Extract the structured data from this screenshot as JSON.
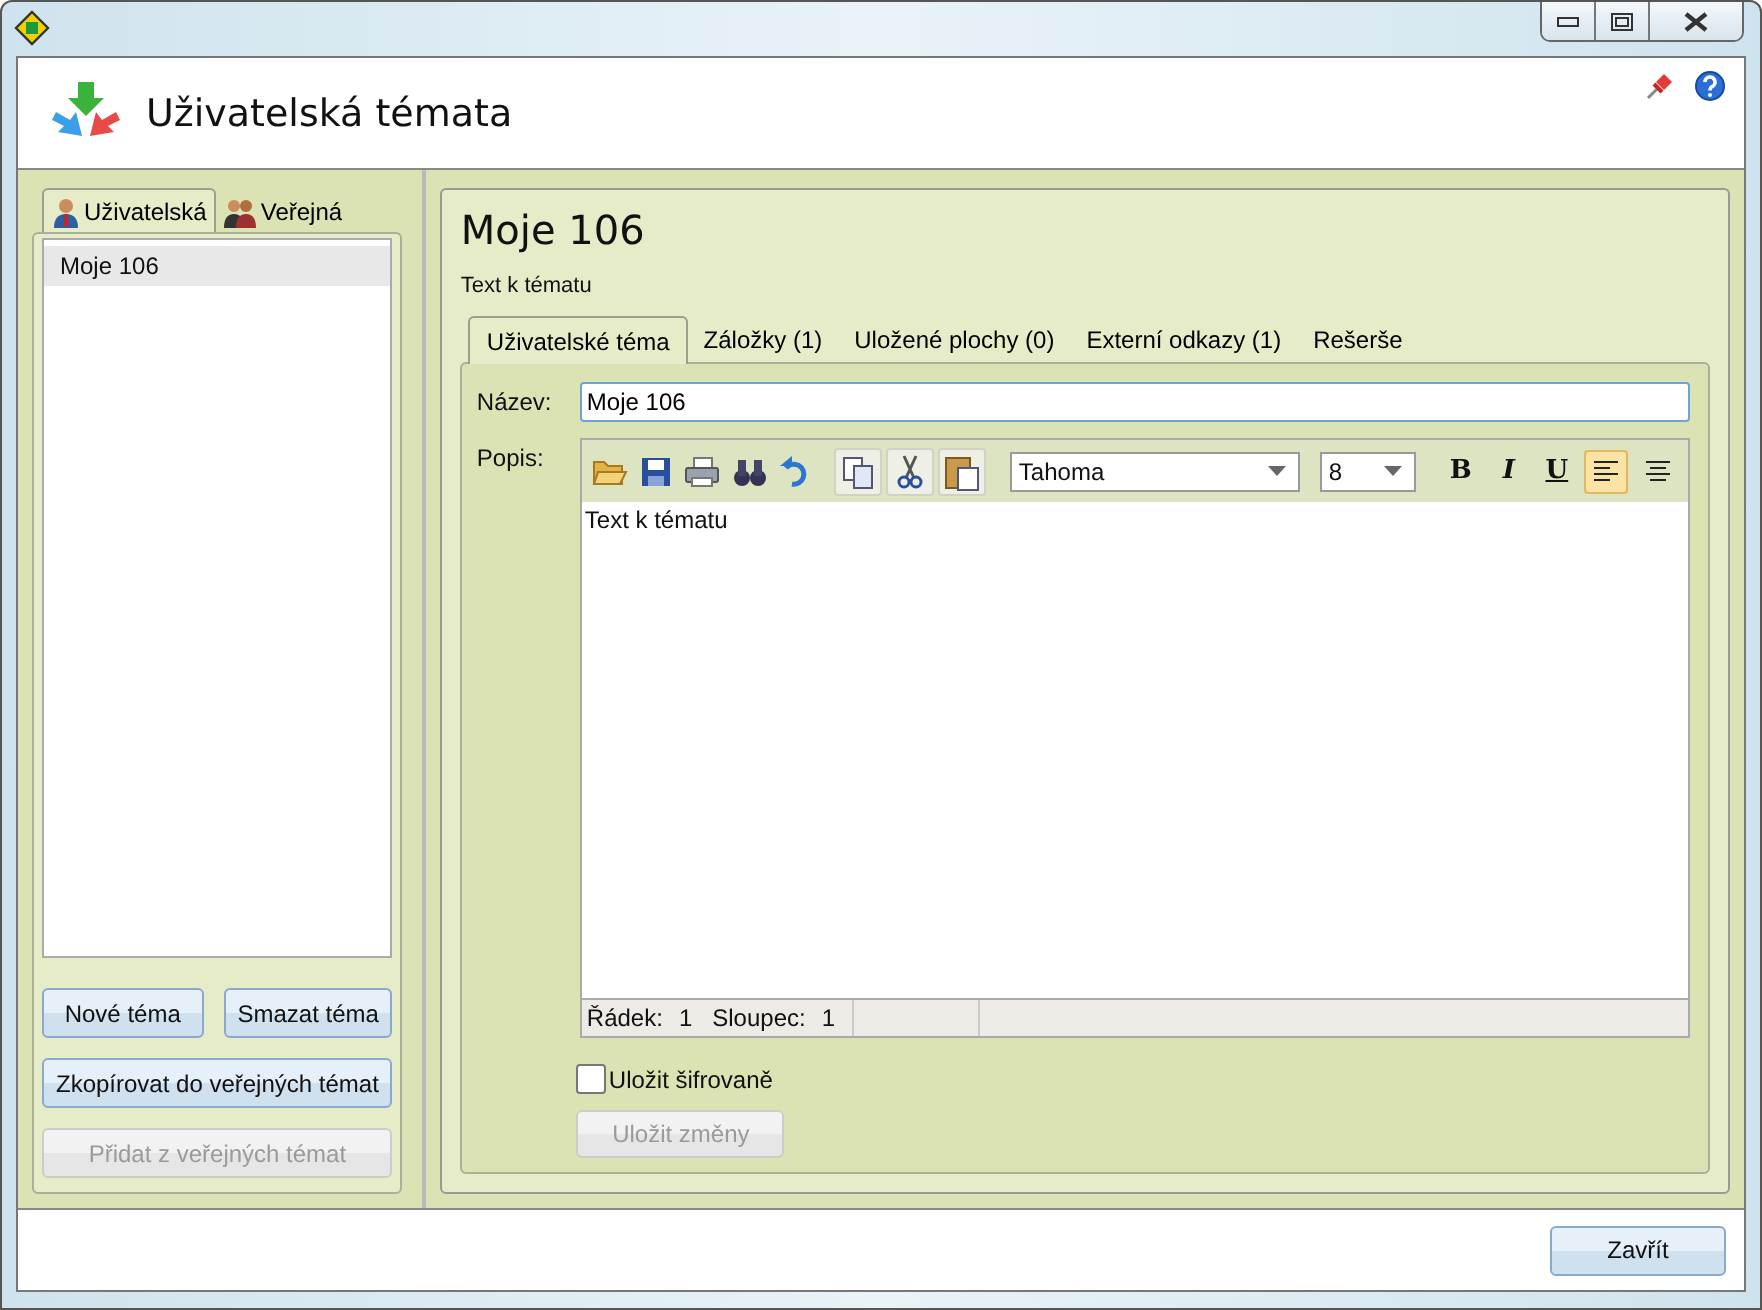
{
  "header": {
    "title": "Uživatelská témata"
  },
  "left": {
    "tabs": [
      {
        "label": "Uživatelská",
        "selected": true,
        "kind": "user"
      },
      {
        "label": "Veřejná",
        "selected": false,
        "kind": "group"
      }
    ],
    "items": [
      {
        "label": "Moje 106",
        "selected": true
      }
    ],
    "buttons": [
      {
        "label": "Nové téma",
        "disabled": false,
        "kind": "half"
      },
      {
        "label": "Smazat téma",
        "disabled": false,
        "kind": "half"
      },
      {
        "label": "Zkopírovat do veřejných témat",
        "disabled": false,
        "kind": "full"
      },
      {
        "label": "Přidat z veřejných témat",
        "disabled": true,
        "kind": "full"
      }
    ]
  },
  "topic": {
    "title": "Moje 106",
    "subtitle": "Text k tématu",
    "tabs": [
      {
        "label": "Uživatelské téma",
        "selected": true
      },
      {
        "label": "Záložky (1)",
        "selected": false
      },
      {
        "label": "Uložené plochy (0)",
        "selected": false
      },
      {
        "label": "Externí odkazy (1)",
        "selected": false
      },
      {
        "label": "Rešerše",
        "selected": false
      }
    ],
    "name_label": "Název:",
    "name_value": "Moje 106",
    "description_label": "Popis:",
    "editor": {
      "tools": [
        {
          "kind": "open"
        },
        {
          "kind": "save"
        },
        {
          "kind": "print"
        },
        {
          "kind": "find"
        },
        {
          "kind": "undo"
        }
      ],
      "clipboard": [
        {
          "kind": "copy"
        },
        {
          "kind": "cut"
        },
        {
          "kind": "paste"
        }
      ],
      "font": "Tahoma",
      "size": "8",
      "format": [
        {
          "glyph": "B",
          "kind": "bold",
          "active": false
        },
        {
          "glyph": "I",
          "kind": "italic",
          "active": false
        },
        {
          "glyph": "U",
          "kind": "underline",
          "active": false
        }
      ],
      "align": [
        {
          "kind": "left",
          "active": true
        },
        {
          "kind": "center",
          "active": false
        }
      ],
      "text": "Text k tématu",
      "status": [
        {
          "label": "Řádek:",
          "value": "1"
        },
        {
          "label": "Sloupec:",
          "value": "1"
        }
      ]
    },
    "encrypt": {
      "label": "Uložit šifrovaně",
      "checked": false
    },
    "save_button": {
      "label": "Uložit změny",
      "disabled": true
    }
  },
  "footer": {
    "close_button": "Zavřít"
  }
}
